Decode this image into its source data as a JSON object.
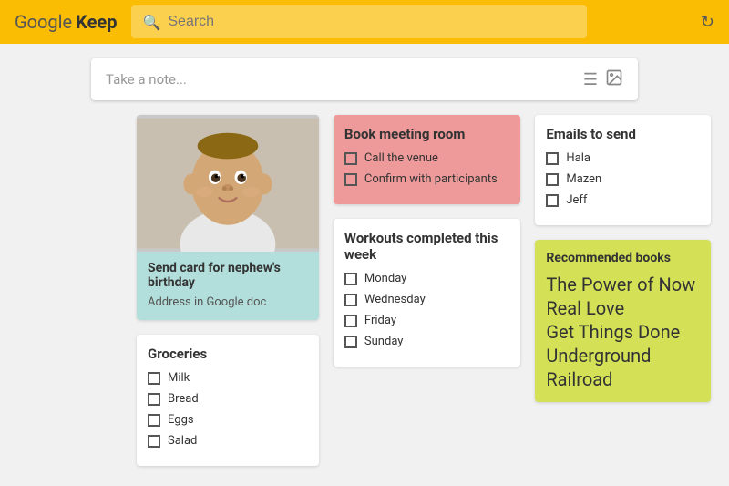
{
  "header": {
    "logo_google": "Google",
    "logo_keep": "Keep",
    "search_placeholder": "Search",
    "refresh_icon": "↻"
  },
  "note_input": {
    "placeholder": "Take a note...",
    "list_icon": "≡",
    "image_icon": "🖼"
  },
  "notes": {
    "baby_card": {
      "title": "Send card for nephew's birthday",
      "text": "Address in Google doc"
    },
    "book_meeting": {
      "title": "Book meeting room",
      "items": [
        "Call the venue",
        "Confirm with participants"
      ]
    },
    "emails": {
      "title": "Emails to send",
      "items": [
        "Hala",
        "Mazen",
        "Jeff"
      ]
    },
    "workouts": {
      "title": "Workouts completed this week",
      "items": [
        "Monday",
        "Wednesday",
        "Friday",
        "Sunday"
      ]
    },
    "books": {
      "title": "Recommended books",
      "items": [
        "The Power of Now",
        "Real Love",
        "Get Things Done",
        "Underground Railroad"
      ]
    },
    "groceries": {
      "title": "Groceries",
      "items": [
        "Milk",
        "Bread",
        "Eggs",
        "Salad"
      ]
    }
  }
}
